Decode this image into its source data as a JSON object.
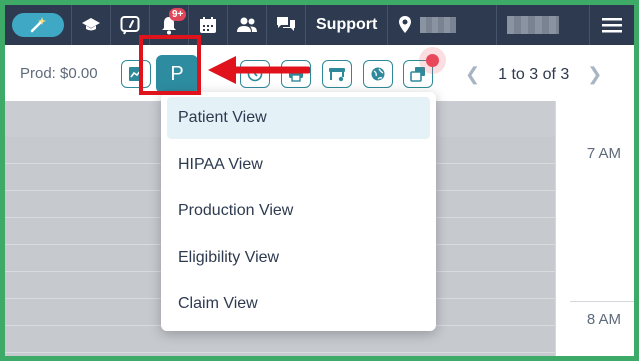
{
  "nav": {
    "notification_badge": "9+",
    "support_label": "Support"
  },
  "toolbar": {
    "production_label": "Prod: $0.00",
    "view_button_letter": "P",
    "pagination_text": "1 to 3 of 3"
  },
  "view_menu": {
    "items": [
      {
        "label": "Patient View",
        "selected": true
      },
      {
        "label": "HIPAA View",
        "selected": false
      },
      {
        "label": "Production View",
        "selected": false
      },
      {
        "label": "Eligibility View",
        "selected": false
      },
      {
        "label": "Claim View",
        "selected": false
      }
    ]
  },
  "schedule": {
    "time_labels": [
      "7 AM",
      "8 AM"
    ]
  },
  "colors": {
    "nav_background": "#2d3a4f",
    "accent_teal": "#2e8ca0",
    "annotation_red": "#e0121b",
    "frame_green": "#3daa68"
  }
}
